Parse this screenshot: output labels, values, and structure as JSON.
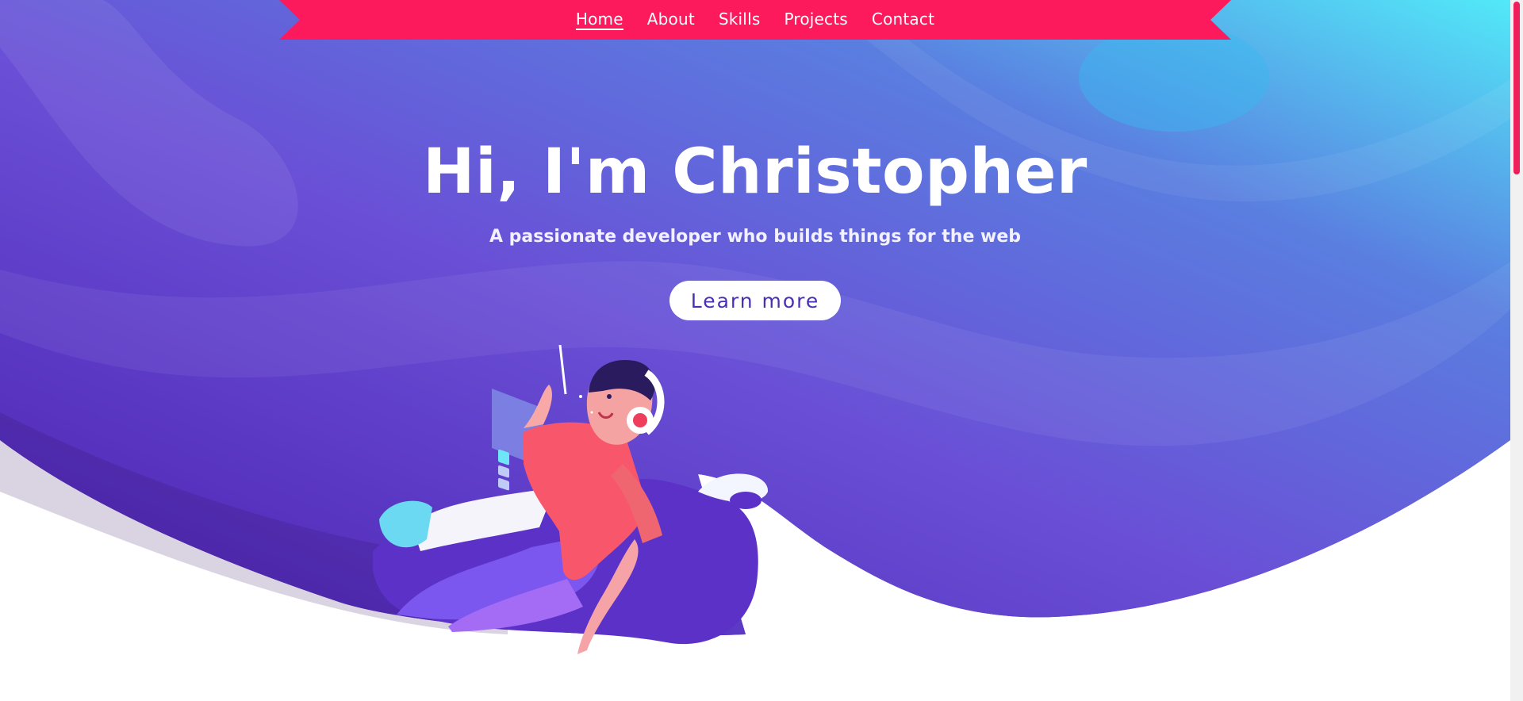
{
  "nav": {
    "items": [
      {
        "label": "Home",
        "active": true
      },
      {
        "label": "About",
        "active": false
      },
      {
        "label": "Skills",
        "active": false
      },
      {
        "label": "Projects",
        "active": false
      },
      {
        "label": "Contact",
        "active": false
      }
    ]
  },
  "hero": {
    "title": "Hi, I'm Christopher",
    "subtitle": "A passionate developer who builds things for the web",
    "cta_label": "Learn more"
  },
  "colors": {
    "nav_ribbon": "#fc1a5c",
    "hero_gradient_start": "#5227c4",
    "hero_gradient_end": "#52e7f7",
    "cta_text": "#4a2fb3",
    "scroll_thumb": "#ef1f5c"
  },
  "icons": {
    "illustration": "developer-with-headphones-illustration"
  }
}
